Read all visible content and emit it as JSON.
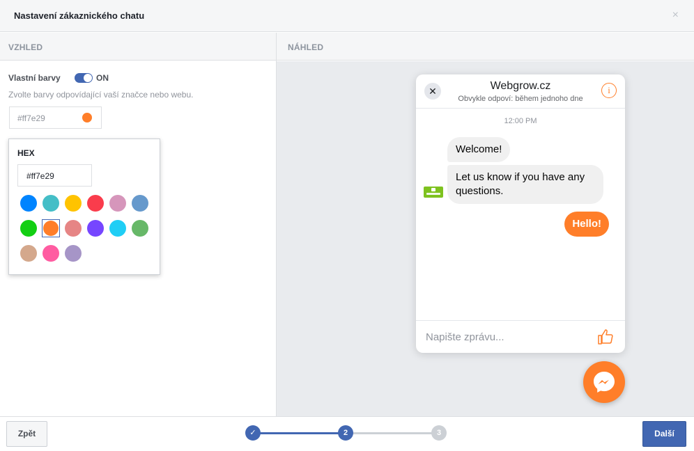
{
  "dialog": {
    "title": "Nastavení zákaznického chatu",
    "close_symbol": "×"
  },
  "sections": {
    "left": "VZHLED",
    "right": "NÁHLED"
  },
  "appearance": {
    "custom_colors_label": "Vlastní barvy",
    "toggle_state": "ON",
    "helper": "Zvolte barvy odpovídající vaší značce nebo webu.",
    "color_value": "#ff7e29",
    "selected_color": "#ff7e29"
  },
  "picker": {
    "label": "HEX",
    "hex_value": "#ff7e29",
    "swatches": [
      "#0084ff",
      "#44bec7",
      "#ffc300",
      "#fa3c4c",
      "#d696bb",
      "#6699cc",
      "#13cf13",
      "#ff7e29",
      "#e68585",
      "#7646ff",
      "#20cef5",
      "#67b868",
      "#d4a88c",
      "#ff5ca1",
      "#a695c7"
    ],
    "selected_index": 7
  },
  "preview": {
    "page_name": "Webgrow.cz",
    "response_time": "Obvykle odpoví: během jednoho dne",
    "time": "12:00 PM",
    "msg_in_1": "Welcome!",
    "msg_in_2": "Let us know if you have any questions.",
    "msg_out": "Hello!",
    "composer_placeholder": "Napište zprávu...",
    "info_symbol": "i",
    "close_symbol": "✕",
    "accent": "#ff7e29"
  },
  "footer": {
    "back_label": "Zpět",
    "next_label": "Další",
    "steps": [
      {
        "label": "✓",
        "state": "done"
      },
      {
        "label": "2",
        "state": "active"
      },
      {
        "label": "3",
        "state": "todo"
      }
    ]
  }
}
